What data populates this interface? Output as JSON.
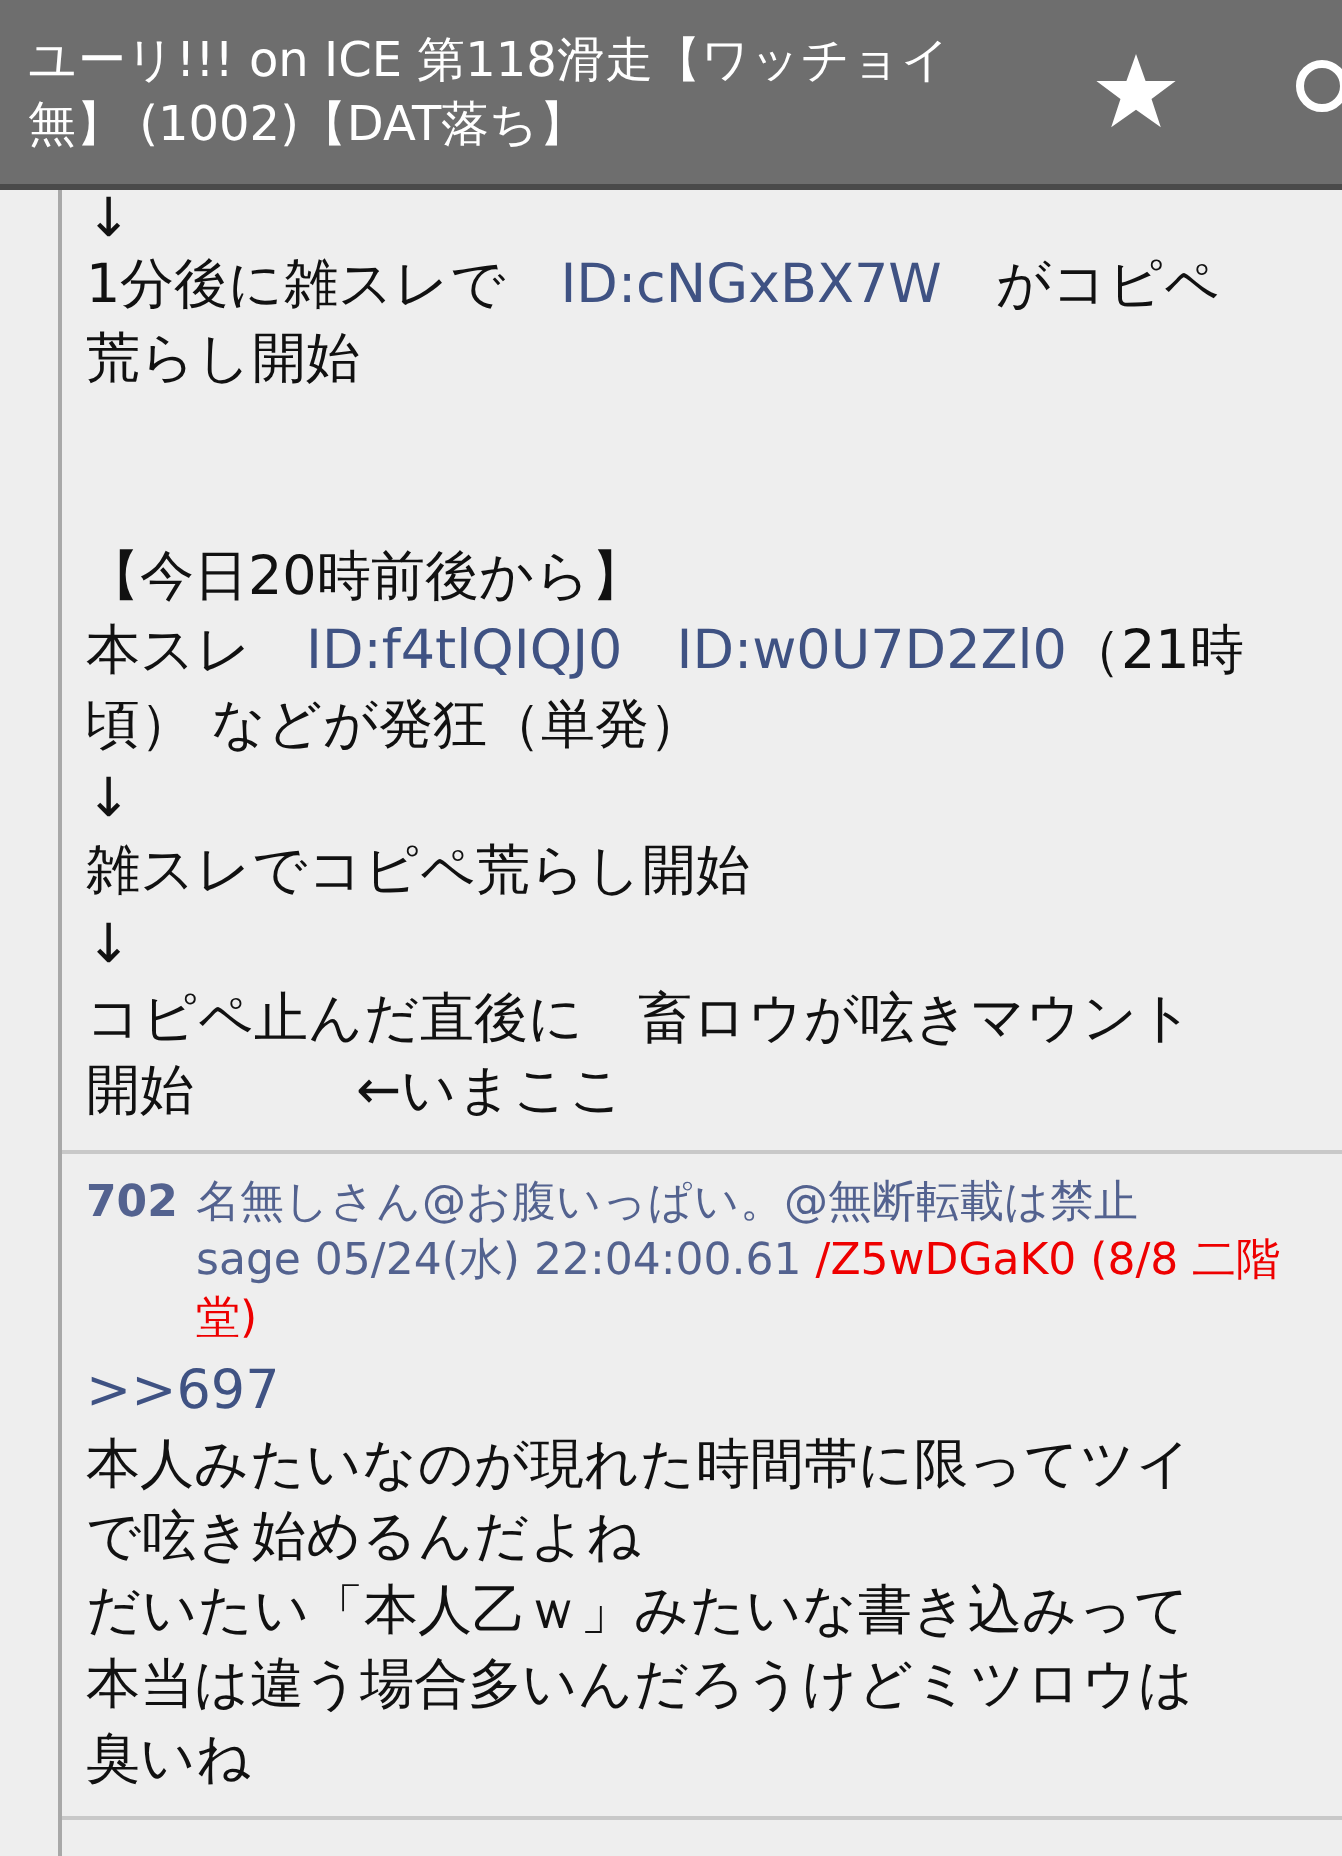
{
  "header": {
    "title": "ユーリ!!! on ICE 第118滑走【ワッチョイ無】 (1002)【DAT落ち】"
  },
  "posts": [
    {
      "lines": [
        {
          "segments": [
            {
              "kind": "text",
              "text": "↓"
            }
          ]
        },
        {
          "segments": [
            {
              "kind": "text",
              "text": "1分後に雑スレで　"
            },
            {
              "kind": "id",
              "text": "ID:cNGxBX7W"
            },
            {
              "kind": "text",
              "text": "　がコピペ"
            }
          ]
        },
        {
          "segments": [
            {
              "kind": "text",
              "text": "荒らし開始"
            }
          ]
        },
        {
          "gap_before": true,
          "segments": [
            {
              "kind": "text",
              "text": "【今日20時前後から】"
            }
          ]
        },
        {
          "segments": [
            {
              "kind": "text",
              "text": "本スレ　"
            },
            {
              "kind": "id",
              "text": "ID:f4tlQIQJ0　"
            },
            {
              "kind": "id",
              "text": "ID:w0U7D2Zl0"
            },
            {
              "kind": "text",
              "text": "（21時"
            }
          ]
        },
        {
          "segments": [
            {
              "kind": "text",
              "text": "頃） などが発狂（単発）"
            }
          ]
        },
        {
          "segments": [
            {
              "kind": "text",
              "text": "↓"
            }
          ]
        },
        {
          "segments": [
            {
              "kind": "text",
              "text": "雑スレでコピペ荒らし開始"
            }
          ]
        },
        {
          "segments": [
            {
              "kind": "text",
              "text": "↓"
            }
          ]
        },
        {
          "segments": [
            {
              "kind": "text",
              "text": "コピペ止んだ直後に　畜ロウが呟きマウント"
            }
          ]
        },
        {
          "segments": [
            {
              "kind": "text",
              "text": "開始　　　←いまここ"
            }
          ]
        }
      ]
    },
    {
      "number": "702",
      "name": "名無しさん@お腹いっぱい。@無断転載は禁止",
      "date": "sage 05/24(水) 22:04:00.61",
      "user_id": "/Z5wDGaK0 (8/8 二階堂)",
      "lines": [
        {
          "segments": [
            {
              "kind": "anchor",
              "text": ">>697"
            }
          ]
        },
        {
          "segments": [
            {
              "kind": "text",
              "text": "本人みたいなのが現れた時間帯に限ってツイ"
            }
          ]
        },
        {
          "segments": [
            {
              "kind": "text",
              "text": "で呟き始めるんだよね"
            }
          ]
        },
        {
          "segments": [
            {
              "kind": "text",
              "text": "だいたい「本人乙ｗ」みたいな書き込みって"
            }
          ]
        },
        {
          "segments": [
            {
              "kind": "text",
              "text": "本当は違う場合多いんだろうけどミツロウは"
            }
          ]
        },
        {
          "segments": [
            {
              "kind": "text",
              "text": "臭いね"
            }
          ]
        }
      ]
    }
  ]
}
